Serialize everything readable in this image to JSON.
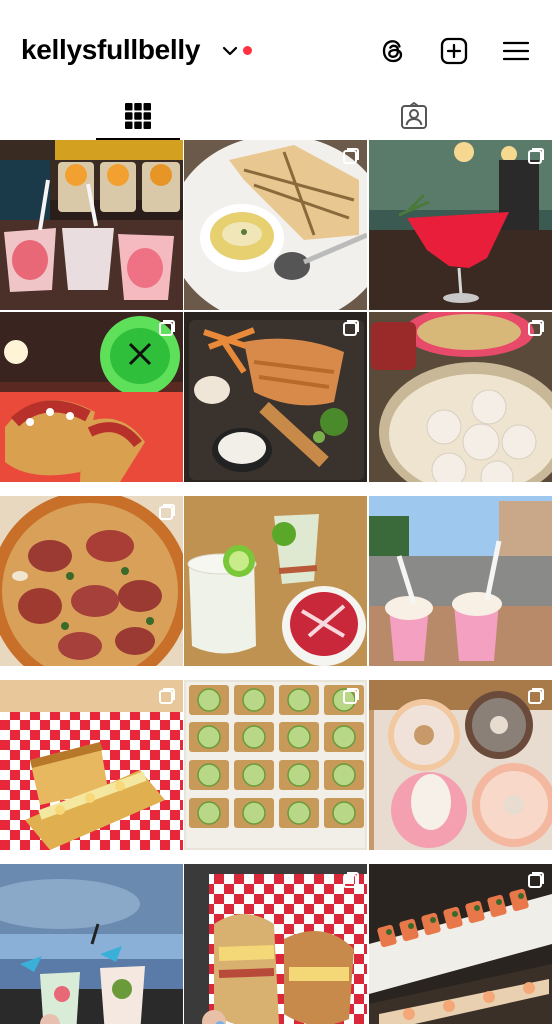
{
  "profile": {
    "username": "kellysfullbelly",
    "notification_color": "#ff3040"
  },
  "header_icons": [
    "threads-icon",
    "create-post-icon",
    "menu-icon"
  ],
  "tabs": [
    {
      "name": "grid",
      "icon": "grid-icon",
      "selected": true
    },
    {
      "name": "tagged",
      "icon": "tagged-icon",
      "selected": false
    }
  ],
  "posts": [
    {
      "id": 1,
      "subject": "frozen-drinks",
      "multi": true
    },
    {
      "id": 2,
      "subject": "flatbread-dip",
      "multi": true
    },
    {
      "id": 3,
      "subject": "red-cocktail",
      "multi": true
    },
    {
      "id": 4,
      "subject": "tacos",
      "multi": true
    },
    {
      "id": 5,
      "subject": "fries-platter",
      "multi": true
    },
    {
      "id": 6,
      "subject": "dumplings",
      "multi": true
    },
    {
      "id": 7,
      "subject": "pizza",
      "multi": true
    },
    {
      "id": 8,
      "subject": "margaritas",
      "multi": false
    },
    {
      "id": 9,
      "subject": "ice-cream-street",
      "multi": false
    },
    {
      "id": 10,
      "subject": "grilled-cheese",
      "multi": true
    },
    {
      "id": 11,
      "subject": "cucumber-toasts",
      "multi": true
    },
    {
      "id": 12,
      "subject": "donuts",
      "multi": true
    },
    {
      "id": 13,
      "subject": "beach-drinks",
      "multi": false
    },
    {
      "id": 14,
      "subject": "bagel-sandwich",
      "multi": true
    },
    {
      "id": 15,
      "subject": "sushi-rolls",
      "multi": true
    }
  ]
}
